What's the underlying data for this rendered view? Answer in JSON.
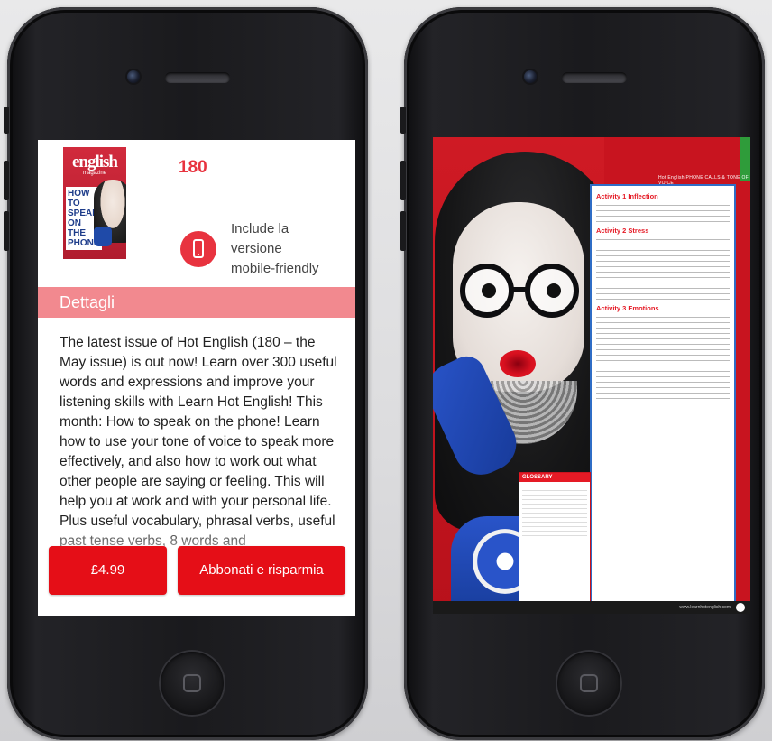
{
  "product": {
    "issue_number": "180",
    "cover": {
      "masthead": "english",
      "magazine_label": "magazine",
      "headline": "HOW TO SPEAK ON THE PHONE"
    },
    "mobile_badge_text": "Include la\nversione\nmobile-friendly",
    "details_heading": "Dettagli",
    "description": "The latest issue of Hot English (180 – the May issue) is out now! Learn over 300 useful words and expressions and improve your listening skills with Learn Hot English! This month: How to speak on the phone! Learn how to use your tone of voice to speak more effectively, and also how to work out what other people are saying or feeling. This will help you at work and with your personal life. Plus useful vocabulary, phrasal verbs, useful past tense verbs, 8 words and",
    "price_button": "£4.99",
    "subscribe_button": "Abbonati e risparmia"
  },
  "preview_page": {
    "header_text": "Hot English PHONE CALLS & TONE OF VOICE",
    "sections": [
      {
        "title": "Activity 1 Inflection"
      },
      {
        "title": "Activity 2 Stress"
      },
      {
        "title": "Activity 3 Emotions"
      }
    ],
    "glossary_title": "GLOSSARY",
    "footer_text": "www.learnhotenglish.com"
  },
  "colors": {
    "accent_red": "#e8333f",
    "button_red": "#e50e17",
    "details_bar_pink": "#f2898f"
  },
  "icons": [
    "camera-icon",
    "speaker-icon",
    "home-button-icon",
    "mobile-device-icon"
  ]
}
